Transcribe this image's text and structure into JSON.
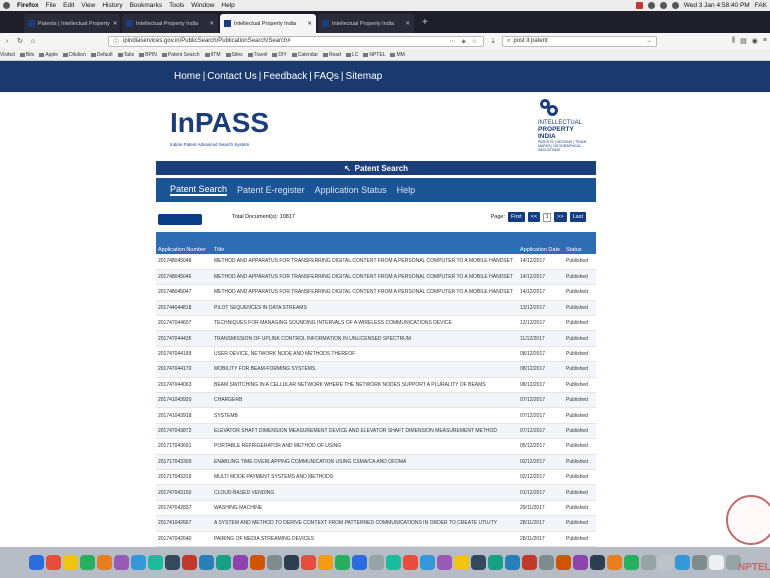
{
  "menubar": {
    "app": "Firefox",
    "items": [
      "File",
      "Edit",
      "View",
      "History",
      "Bookmarks",
      "Tools",
      "Window",
      "Help"
    ],
    "clock": "Wed 3 Jan 4:58:40 PM",
    "user": "FAK"
  },
  "tabs": [
    {
      "label": "Patents | Intellectual Property",
      "active": false
    },
    {
      "label": "Intellectual Property India",
      "active": false
    },
    {
      "label": "Intellectual Property India",
      "active": true
    },
    {
      "label": "Intellectual Property India",
      "active": false
    }
  ],
  "browser": {
    "url": "ipindiaservices.gov.in/PublicSearch/PublicationSearch/Search#",
    "search_value": "post it patent",
    "bookmarks": [
      "Visited",
      "Bits",
      "Apple",
      "Dilution",
      "Default",
      "Tabs",
      "BPIN",
      "Patent Search",
      "IITM",
      "Sites",
      "Travel",
      "DIY",
      "Calendar",
      "Read",
      "LC",
      "NPTEL",
      "MM"
    ]
  },
  "site": {
    "topnav": [
      "Home",
      "Contact Us",
      "Feedback",
      "FAQs",
      "Sitemap"
    ],
    "logo_text": "InPASS",
    "logo_sub": "Indian Patent Advanced Search System",
    "ipi_line1": "INTELLECTUAL",
    "ipi_line2": "PROPERTY INDIA",
    "ipi_line3": "PATENTS | DESIGNS | TRADE MARKS | GEOGRAPHICAL INDICATIONS",
    "page_title": "Patent Search",
    "tabs": [
      "Patent Search",
      "Patent E-register",
      "Application Status",
      "Help"
    ],
    "total_documents": "Total Document(s): 10817",
    "page_label": "Page:",
    "btn_first": "First",
    "btn_prev": "<<",
    "page_value": "1",
    "btn_next": ">>",
    "btn_last": "Last"
  },
  "table": {
    "headers": [
      "Application Number",
      "Title",
      "Application Date",
      "Status"
    ],
    "rows": [
      [
        "201748045048",
        "METHOD AND APPARATUS FOR TRANSFERRING DIGITAL CONTENT FROM A PERSONAL COMPUTER TO A MOBILE HANDSET",
        "14/12/2017",
        "Published"
      ],
      [
        "201748045046",
        "METHOD AND APPARATUS FOR TRANSFERRING DIGITAL CONTENT FROM A PERSONAL COMPUTER TO A MOBILE HANDSET",
        "14/12/2017",
        "Published"
      ],
      [
        "201748045047",
        "METHOD AND APPARATUS FOR TRANSFERRING DIGITAL CONTENT FROM A PERSONAL COMPUTER TO A MOBILE HANDSET",
        "14/12/2017",
        "Published"
      ],
      [
        "201744044818",
        "PILOT SEQUENCES IN DATA STREAMS",
        "13/12/2017",
        "Published"
      ],
      [
        "201747044607",
        "TECHNIQUES FOR MANAGING SOUNDING INTERVALS OF A WIRELESS COMMUNICATIONS DEVICE",
        "12/12/2017",
        "Published"
      ],
      [
        "201747044435",
        "TRANSMISSION OF UPLINK CONTROL INFORMATION IN UNLICENSED SPECTRUM",
        "11/12/2017",
        "Published"
      ],
      [
        "201747044199",
        "USER DEVICE, NETWORK NODE AND METHODS THEREOF",
        "08/12/2017",
        "Published"
      ],
      [
        "201747044170",
        "MOBILITY FOR BEAM-FORMING SYSTEMS",
        "08/12/2017",
        "Published"
      ],
      [
        "201747044063",
        "BEAM SWITCHING IN A CELLULAR NETWORK WHERE THE NETWORK NODES SUPPORT A PLURALITY OF BEAMS",
        "08/12/2017",
        "Published"
      ],
      [
        "201741043920",
        "CHARGERB",
        "07/12/2017",
        "Published"
      ],
      [
        "201741043918",
        "SYSTEMB",
        "07/12/2017",
        "Published"
      ],
      [
        "201747043872",
        "ELEVATOR SHAFT DIMENSION MEASUREMENT DEVICE AND ELEVATOR SHAFT DIMENSION MEASUREMENT METHOD",
        "07/12/2017",
        "Published"
      ],
      [
        "201717043601",
        "PORTABLE REFRIGERATOR AND METHOD OF USING",
        "05/12/2017",
        "Published"
      ],
      [
        "201717043309",
        "ENABLING TIME OVERLAPPING COMMUNICATION USING CSMA/CA AND OFDMA",
        "02/12/2017",
        "Published"
      ],
      [
        "201717043319",
        "MULTI MODE PAYMENT SYSTEMS AND METHODS",
        "02/12/2017",
        "Published"
      ],
      [
        "201747043150",
        "CLOUD-BASED VENDING",
        "01/12/2017",
        "Published"
      ],
      [
        "201747042837",
        "WASHING MACHINE",
        "29/11/2017",
        "Published"
      ],
      [
        "201741042667",
        "A SYSTEM AND METHOD TO DERIVE CONTEXT FROM PATTERNED COMMUNICATIONS IN ORDER TO CREATE UTILITY",
        "28/11/2017",
        "Published"
      ],
      [
        "201747042640",
        "PAIRING OF MEDIA STREAMING DEVICES",
        "28/11/2017",
        "Published"
      ]
    ]
  },
  "watermark": "NPTEL",
  "colors": {
    "navy": "#1a3a6e",
    "tab_blue": "#1b5494",
    "header_blue": "#2e6db4"
  }
}
